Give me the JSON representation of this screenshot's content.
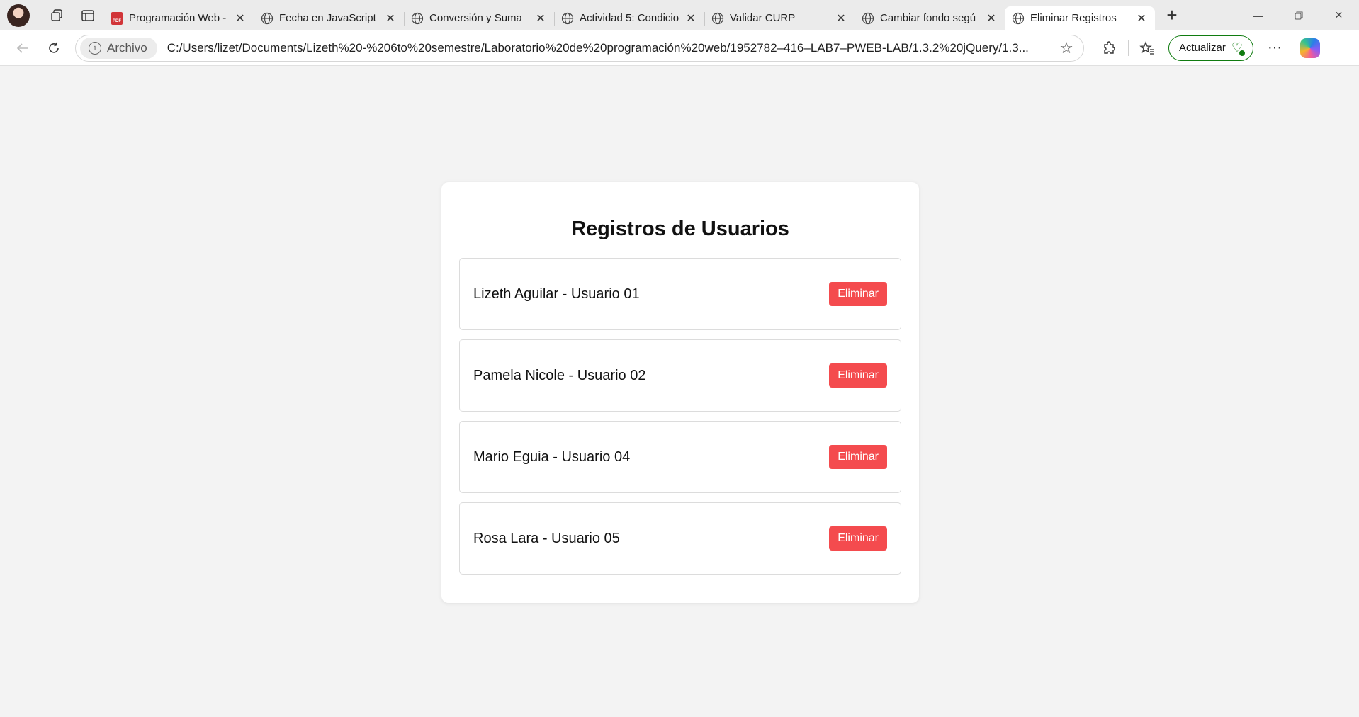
{
  "browser": {
    "tabs": [
      {
        "title": "Programación Web -",
        "favicon": "pdf-icon",
        "active": false
      },
      {
        "title": "Fecha en JavaScript",
        "favicon": "globe-icon",
        "active": false
      },
      {
        "title": "Conversión y Suma",
        "favicon": "globe-icon",
        "active": false
      },
      {
        "title": "Actividad 5: Condicio",
        "favicon": "globe-icon",
        "active": false
      },
      {
        "title": "Validar CURP",
        "favicon": "globe-icon",
        "active": false
      },
      {
        "title": "Cambiar fondo segú",
        "favicon": "globe-icon",
        "active": false
      },
      {
        "title": "Eliminar Registros",
        "favicon": "globe-icon",
        "active": true
      }
    ],
    "site_chip": "Archivo",
    "url": "C:/Users/lizet/Documents/Lizeth%20-%206to%20semestre/Laboratorio%20de%20programación%20web/1952782–416–LAB7–PWEB-LAB/1.3.2%20jQuery/1.3...",
    "update_label": "Actualizar"
  },
  "page": {
    "title": "Registros de Usuarios",
    "records": [
      {
        "label": "Lizeth Aguilar - Usuario 01",
        "button": "Eliminar"
      },
      {
        "label": "Pamela Nicole - Usuario 02",
        "button": "Eliminar"
      },
      {
        "label": "Mario Eguia - Usuario 04",
        "button": "Eliminar"
      },
      {
        "label": "Rosa Lara - Usuario 05",
        "button": "Eliminar"
      }
    ]
  },
  "colors": {
    "delete_button": "#f44b4e",
    "update_border": "#107c10",
    "page_background": "#f3f3f3"
  }
}
